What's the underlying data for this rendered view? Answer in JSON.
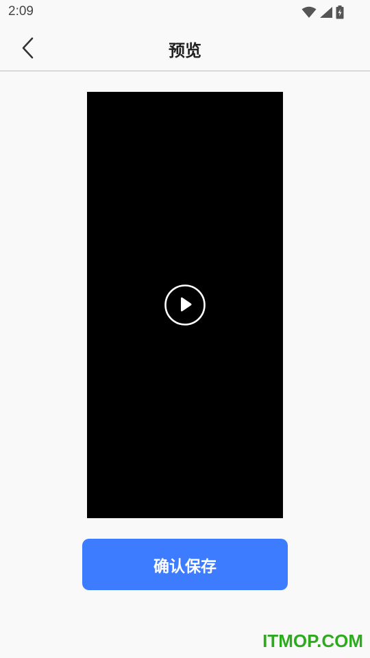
{
  "status_bar": {
    "time": "2:09",
    "icons": [
      "wifi-icon",
      "cellular-signal-icon",
      "battery-charging-icon"
    ]
  },
  "header": {
    "back_icon": "chevron-left-icon",
    "title": "预览"
  },
  "video_preview": {
    "background": "#000000",
    "play_icon": "play-circle-icon"
  },
  "actions": {
    "confirm_label": "确认保存",
    "confirm_color": "#3d7bff"
  },
  "watermark": {
    "text": "ITMOP.COM",
    "color": "#2eaa1f"
  }
}
